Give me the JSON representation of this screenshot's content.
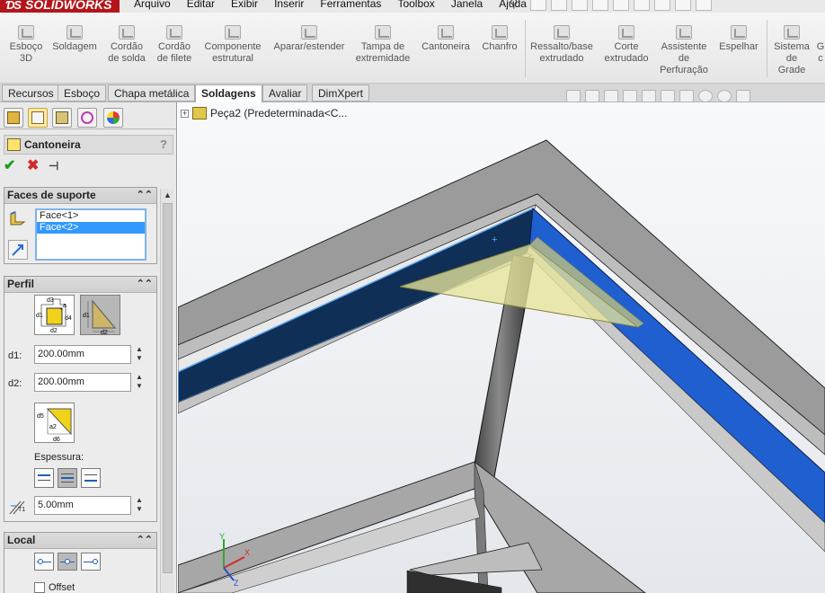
{
  "app": {
    "logo_prefix": "ƊS",
    "logo_text": "SOLIDWORKS"
  },
  "menu": [
    "Arquivo",
    "Editar",
    "Exibir",
    "Inserir",
    "Ferramentas",
    "Toolbox",
    "Janela",
    "Ajuda"
  ],
  "ribbon": {
    "commands": [
      {
        "label_l1": "Esboço",
        "label_l2": "3D",
        "label_l3": ""
      },
      {
        "label_l1": "Soldagem",
        "label_l2": "",
        "label_l3": ""
      },
      {
        "label_l1": "Cordão",
        "label_l2": "de solda",
        "label_l3": ""
      },
      {
        "label_l1": "Cordão",
        "label_l2": "de filete",
        "label_l3": ""
      },
      {
        "label_l1": "Componente",
        "label_l2": "estrutural",
        "label_l3": ""
      },
      {
        "label_l1": "Aparar/estender",
        "label_l2": "",
        "label_l3": ""
      },
      {
        "label_l1": "Tampa de",
        "label_l2": "extremidade",
        "label_l3": ""
      },
      {
        "label_l1": "Cantoneira",
        "label_l2": "",
        "label_l3": ""
      },
      {
        "label_l1": "Chanfro",
        "label_l2": "",
        "label_l3": ""
      },
      {
        "label_l1": "Ressalto/base",
        "label_l2": "extrudado",
        "label_l3": ""
      },
      {
        "label_l1": "Corte",
        "label_l2": "extrudado",
        "label_l3": ""
      },
      {
        "label_l1": "Assistente",
        "label_l2": "de",
        "label_l3": "Perfuração"
      },
      {
        "label_l1": "Espelhar",
        "label_l2": "",
        "label_l3": ""
      },
      {
        "label_l1": "Sistema",
        "label_l2": "de",
        "label_l3": "Grade"
      },
      {
        "label_l1": "G",
        "label_l2": "c",
        "label_l3": ""
      }
    ]
  },
  "tabs": [
    "Recursos",
    "Esboço",
    "Chapa metálica",
    "Soldagens",
    "Avaliar",
    "DimXpert"
  ],
  "active_tab": "Soldagens",
  "property_manager": {
    "title": "Cantoneira",
    "help": "?",
    "ok_symbol": "✔",
    "cancel_symbol": "✖",
    "supporting_faces": {
      "title": "Faces de suporte",
      "items": [
        "Face<1>",
        "Face<2>"
      ],
      "selected": "Face<2>"
    },
    "profile": {
      "title": "Perfil",
      "dim_labels": [
        "d1",
        "d2",
        "d3",
        "d4",
        "a",
        "d5",
        "d6",
        "a2"
      ],
      "d1_label": "d1:",
      "d1_value": "200.00mm",
      "d2_label": "d2:",
      "d2_value": "200.00mm",
      "thickness_label": "Espessura:",
      "t1_label": "T1",
      "t1_value": "5.00mm"
    },
    "location": {
      "title": "Local",
      "offset_label": "Offset"
    }
  },
  "graphics": {
    "tree_root": "Peça2  (Predeterminada<C...",
    "triad_labels": [
      "Y",
      "X",
      "Z"
    ],
    "colors": {
      "frame": "#9a9a9a",
      "selected_face": "#1f5fd0",
      "gusset": "#e6e49a",
      "background": "#eef0f3"
    }
  }
}
